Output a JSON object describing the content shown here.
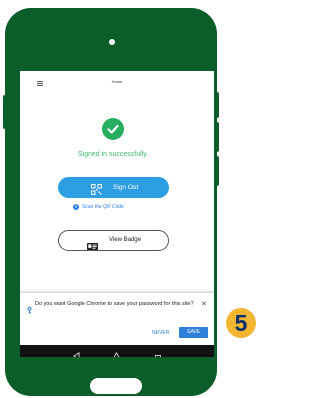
{
  "appbar": {
    "title": "Home",
    "menu_icon": "hamburger-menu-icon"
  },
  "status": {
    "icon": "check-circle-icon",
    "message": "Signed in successfully."
  },
  "actions": {
    "sign_out_label": "Sign Out",
    "sign_out_icon": "qr-code-icon",
    "scan_hint": "Scan the QR Code",
    "scan_hint_icon": "info-icon",
    "view_badge_label": "View Badge",
    "view_badge_icon": "id-card-icon"
  },
  "save_password_prompt": {
    "icon": "key-icon",
    "message": "Do you want Google Chrome to save your password for this site?",
    "never_label": "NEVER",
    "save_label": "SAVE",
    "close_icon": "close-icon"
  },
  "android_nav": {
    "back_icon": "back-triangle-icon",
    "home_icon": "home-icon",
    "recent_icon": "recent-apps-icon"
  },
  "step_number": "5",
  "colors": {
    "phone_body": "#0b5d2a",
    "success": "#27ae60",
    "primary_button": "#2e9ee3",
    "link_blue": "#2e7fd8",
    "step_badge": "#f2b632",
    "step_text": "#0b2e6e"
  }
}
